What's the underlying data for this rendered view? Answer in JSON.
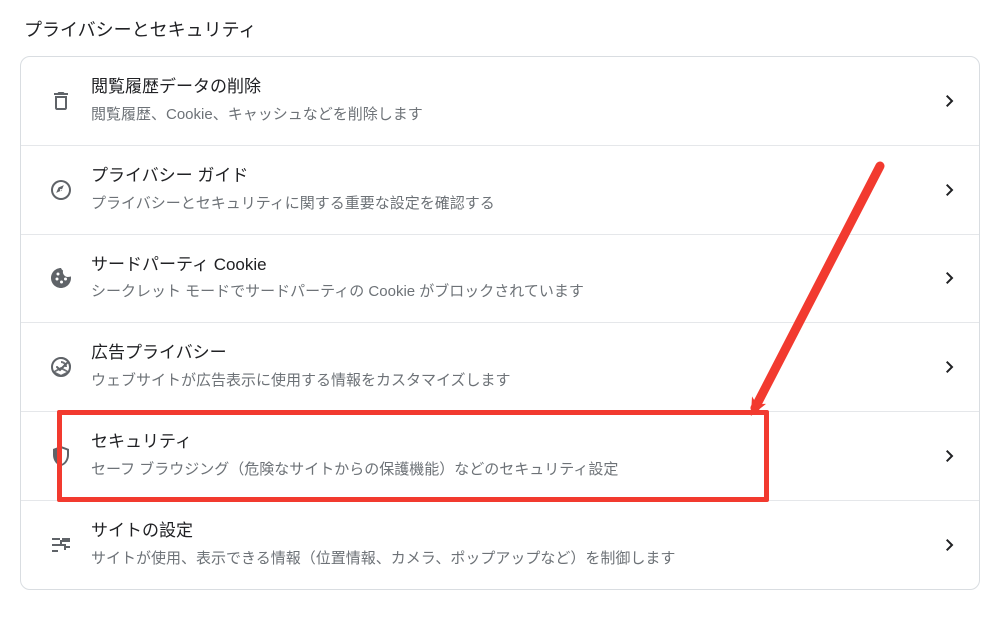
{
  "section_title": "プライバシーとセキュリティ",
  "rows": [
    {
      "icon": "trash-icon",
      "title": "閲覧履歴データの削除",
      "desc": "閲覧履歴、Cookie、キャッシュなどを削除します"
    },
    {
      "icon": "compass-icon",
      "title": "プライバシー ガイド",
      "desc": "プライバシーとセキュリティに関する重要な設定を確認する"
    },
    {
      "icon": "cookie-icon",
      "title": "サードパーティ Cookie",
      "desc": "シークレット モードでサードパーティの Cookie がブロックされています"
    },
    {
      "icon": "ad-target-icon",
      "title": "広告プライバシー",
      "desc": "ウェブサイトが広告表示に使用する情報をカスタマイズします"
    },
    {
      "icon": "shield-icon",
      "title": "セキュリティ",
      "desc": "セーフ ブラウジング（危険なサイトからの保護機能）などのセキュリティ設定"
    },
    {
      "icon": "tune-icon",
      "title": "サイトの設定",
      "desc": "サイトが使用、表示できる情報（位置情報、カメラ、ポップアップなど）を制御します"
    }
  ],
  "highlighted_row_index": 4,
  "annotation": {
    "type": "arrow",
    "color": "#f23a2f"
  }
}
